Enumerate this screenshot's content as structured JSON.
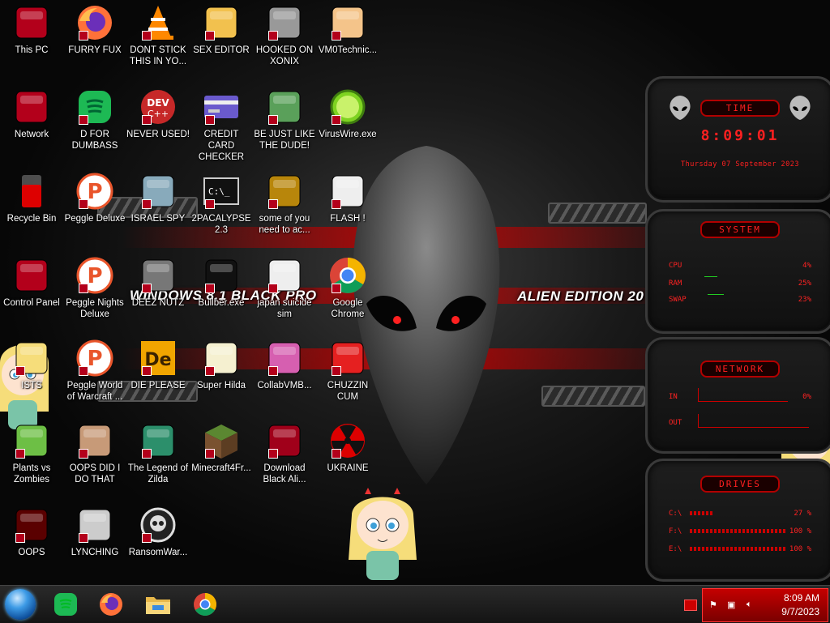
{
  "wallpaper": {
    "text_left": "WINDOWS 8.1 BLACK PRO",
    "text_right": "ALIEN EDITION 20"
  },
  "desktop_icons": [
    {
      "label": "This PC",
      "icon": "monitor-icon"
    },
    {
      "label": "FURRY FUX",
      "icon": "firefox-icon"
    },
    {
      "label": "DONT STICK THIS IN YO...",
      "icon": "vlc-cone-icon"
    },
    {
      "label": "SEX EDITOR",
      "icon": "hxd-editor-icon"
    },
    {
      "label": "HOOKED ON XONIX",
      "icon": "xonix-game-icon"
    },
    {
      "label": "VM0Technic...",
      "icon": "doctor-person-icon"
    },
    {
      "label": "Network",
      "icon": "network-icon"
    },
    {
      "label": "D FOR DUMBASS",
      "icon": "spotify-green-icon"
    },
    {
      "label": "NEVER USED!",
      "icon": "dev-cpp-icon"
    },
    {
      "label": "CREDIT CARD CHECKER",
      "icon": "credit-card-icon"
    },
    {
      "label": "BE JUST LIKE THE DUDE!",
      "icon": "elf-character-icon"
    },
    {
      "label": "VirusWire.exe",
      "icon": "lime-icon"
    },
    {
      "label": "Recycle Bin",
      "icon": "recycle-bin-icon"
    },
    {
      "label": "Peggle Deluxe",
      "icon": "peggle-icon"
    },
    {
      "label": "ISRAEL SPY",
      "icon": "spy-tool-icon"
    },
    {
      "label": "2PACALYPSE 2.3",
      "icon": "terminal-icon"
    },
    {
      "label": "some of you need to ac...",
      "icon": "beaver-icon"
    },
    {
      "label": "FLASH !",
      "icon": "flash-file-icon"
    },
    {
      "label": "Control Panel",
      "icon": "control-panel-icon"
    },
    {
      "label": "Peggle Nights Deluxe",
      "icon": "peggle-icon"
    },
    {
      "label": "DEEZ NUTZ",
      "icon": "stacked-windows-icon"
    },
    {
      "label": "Bullber.exe",
      "icon": "console-small-icon"
    },
    {
      "label": "japan suicide sim",
      "icon": "pixel-file-icon"
    },
    {
      "label": "Google Chrome",
      "icon": "chrome-icon"
    },
    {
      "label": "ISTS",
      "icon": "star-character-icon"
    },
    {
      "label": "Peggle World of Warcraft ...",
      "icon": "peggle-icon"
    },
    {
      "label": "DIE PLEASE",
      "icon": "de-app-icon"
    },
    {
      "label": "Super Hilda",
      "icon": "pixel-dog-icon"
    },
    {
      "label": "CollabVMB...",
      "icon": "pink-window-icon"
    },
    {
      "label": "CHUZZIN CUM",
      "icon": "chuzzle-icon"
    },
    {
      "label": "Plants vs Zombies",
      "icon": "flower-icon"
    },
    {
      "label": "OOPS DID I DO THAT",
      "icon": "portrait-icon"
    },
    {
      "label": "The Legend of Zilda",
      "icon": "pixel-hero-icon"
    },
    {
      "label": "Minecraft4Fr...",
      "icon": "grass-block-icon"
    },
    {
      "label": "Download Black Ali...",
      "icon": "red-orb-icon"
    },
    {
      "label": "UKRAINE",
      "icon": "radiation-icon"
    },
    {
      "label": "OOPS",
      "icon": "red-monitor-icon"
    },
    {
      "label": "LYNCHING",
      "icon": "noose-icon"
    },
    {
      "label": "RansomWar...",
      "icon": "skull-icon"
    }
  ],
  "widgets": {
    "time": {
      "title": "TIME",
      "clock": "8:09:01",
      "date": "Thursday 07 September 2023"
    },
    "system": {
      "title": "SYSTEM",
      "rows": [
        {
          "label": "CPU",
          "value": "4%"
        },
        {
          "label": "RAM",
          "value": "25%"
        },
        {
          "label": "SWAP",
          "value": "23%"
        }
      ]
    },
    "network": {
      "title": "NETWORK",
      "rows": [
        {
          "label": "IN",
          "value": "0%"
        },
        {
          "label": "OUT",
          "value": ""
        }
      ]
    },
    "drives": {
      "title": "DRIVES",
      "rows": [
        {
          "label": "C:\\",
          "value": "27 %"
        },
        {
          "label": "F:\\",
          "value": "100 %"
        },
        {
          "label": "E:\\",
          "value": "100 %"
        }
      ]
    }
  },
  "taskbar": {
    "pinned": [
      {
        "icon": "start-orb-icon"
      },
      {
        "icon": "spotify-green-icon"
      },
      {
        "icon": "firefox-icon"
      },
      {
        "icon": "file-explorer-icon"
      },
      {
        "icon": "chrome-icon"
      }
    ],
    "tray": {
      "time": "8:09 AM",
      "date": "9/7/2023",
      "icons": [
        "flag-icon",
        "network-icon",
        "volume-icon"
      ]
    }
  },
  "colors": {
    "accent_red": "#ff2020",
    "tray_red": "#c40000",
    "taskbar_dark": "#1e1e1e"
  }
}
